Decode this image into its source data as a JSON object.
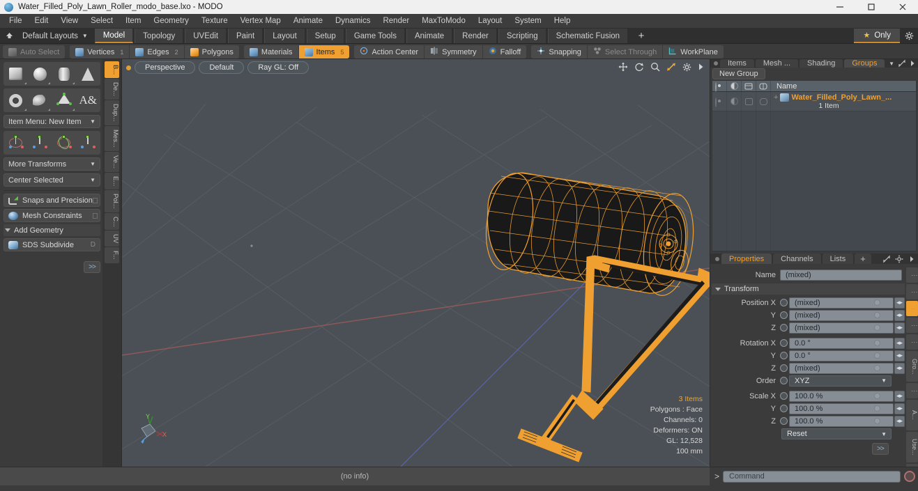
{
  "titlebar": {
    "title": "Water_Filled_Poly_Lawn_Roller_modo_base.lxo - MODO",
    "app_icon": "modo-sphere-icon",
    "minimize": "—",
    "maximize": "□",
    "close": "✕"
  },
  "menubar": {
    "items": [
      {
        "label": "File"
      },
      {
        "label": "Edit"
      },
      {
        "label": "View"
      },
      {
        "label": "Select"
      },
      {
        "label": "Item"
      },
      {
        "label": "Geometry"
      },
      {
        "label": "Texture"
      },
      {
        "label": "Vertex Map"
      },
      {
        "label": "Animate"
      },
      {
        "label": "Dynamics"
      },
      {
        "label": "Render"
      },
      {
        "label": "MaxToModo"
      },
      {
        "label": "Layout"
      },
      {
        "label": "System"
      },
      {
        "label": "Help"
      }
    ]
  },
  "layoutbar": {
    "default_layouts": "Default Layouts",
    "caret": "▼",
    "tabs": [
      {
        "label": "Model",
        "active": true
      },
      {
        "label": "Topology",
        "active": false
      },
      {
        "label": "UVEdit",
        "active": false
      },
      {
        "label": "Paint",
        "active": false
      },
      {
        "label": "Layout",
        "active": false
      },
      {
        "label": "Setup",
        "active": false
      },
      {
        "label": "Game Tools",
        "active": false
      },
      {
        "label": "Animate",
        "active": false
      },
      {
        "label": "Render",
        "active": false
      },
      {
        "label": "Scripting",
        "active": false
      },
      {
        "label": "Schematic Fusion",
        "active": false
      }
    ],
    "add_tab": "+",
    "only_label": "Only",
    "star": "★"
  },
  "modebar": {
    "group1": [
      {
        "label": "Auto Select",
        "num": "",
        "state": "dim",
        "icon": "shield-icon"
      }
    ],
    "group2": [
      {
        "label": "Vertices",
        "num": "1",
        "state": "normal",
        "icon": "vertices-cube-icon"
      },
      {
        "label": "Edges",
        "num": "2",
        "state": "normal",
        "icon": "edges-cube-icon"
      },
      {
        "label": "Polygons",
        "num": "",
        "state": "normal",
        "icon": "polygons-cube-icon"
      }
    ],
    "group3": [
      {
        "label": "Materials",
        "num": "",
        "state": "normal",
        "icon": "materials-cube-icon"
      },
      {
        "label": "Items",
        "num": "5",
        "state": "active",
        "icon": "items-cube-icon"
      }
    ],
    "group4": [
      {
        "label": "Action Center",
        "num": "",
        "state": "normal",
        "icon": "action-center-icon"
      },
      {
        "label": "Symmetry",
        "num": "",
        "state": "normal",
        "icon": "symmetry-icon"
      },
      {
        "label": "Falloff",
        "num": "",
        "state": "normal",
        "icon": "falloff-icon"
      }
    ],
    "group5": [
      {
        "label": "Snapping",
        "num": "",
        "state": "normal",
        "icon": "snapping-icon"
      },
      {
        "label": "Select Through",
        "num": "",
        "state": "dim",
        "icon": "select-through-icon"
      },
      {
        "label": "WorkPlane",
        "num": "",
        "state": "normal",
        "icon": "workplane-icon"
      }
    ]
  },
  "leftbar": {
    "primitives_row1": [
      {
        "name": "cube-tool",
        "shape": "box"
      },
      {
        "name": "sphere-tool",
        "shape": "sphere"
      },
      {
        "name": "cylinder-tool",
        "shape": "cylinder"
      },
      {
        "name": "cone-tool",
        "shape": "cone"
      }
    ],
    "primitives_row2": [
      {
        "name": "torus-tool",
        "shape": "torus"
      },
      {
        "name": "curve-tool",
        "shape": "curve"
      },
      {
        "name": "triangle-tool",
        "shape": "triangle"
      },
      {
        "name": "text-tool",
        "shape": "text"
      }
    ],
    "item_menu": "Item Menu: New Item",
    "transform_row": [
      {
        "name": "move-tool"
      },
      {
        "name": "rotate-tool"
      },
      {
        "name": "scale-tool"
      },
      {
        "name": "transform-tool"
      }
    ],
    "more_transforms": "More Transforms",
    "center_selected": "Center Selected",
    "snaps_precision": "Snaps and Precision",
    "mesh_constraints": "Mesh Constraints",
    "add_geometry": "Add Geometry",
    "sds_subdivide": "SDS Subdivide",
    "sds_key": "D",
    "expand": ">>",
    "vtabs": [
      {
        "label": "B...",
        "active": true
      },
      {
        "label": "De...",
        "active": false
      },
      {
        "label": "Dup...",
        "active": false
      },
      {
        "label": "Mes...",
        "active": false
      },
      {
        "label": "Ve...",
        "active": false
      },
      {
        "label": "E...",
        "active": false
      },
      {
        "label": "Pol...",
        "active": false
      },
      {
        "label": "C...",
        "active": false
      },
      {
        "label": "UV",
        "active": false
      },
      {
        "label": "F...",
        "active": false
      }
    ]
  },
  "viewport": {
    "perspective": "Perspective",
    "shading": "Default",
    "raygl": "Ray GL: Off",
    "nav_icons": [
      "pan-icon",
      "rotate-icon",
      "zoom-icon",
      "fit-icon",
      "settings-gear-icon",
      "expand-arrow-icon"
    ],
    "stats": {
      "items": "3 Items",
      "polygons": "Polygons : Face",
      "channels": "Channels: 0",
      "deformers": "Deformers: ON",
      "gl": "GL: 12,528",
      "scale": "100 mm"
    },
    "axis_labels": {
      "x": "X",
      "y": "Y",
      "z": "Z"
    }
  },
  "rightpanel": {
    "top_tabs": [
      {
        "label": "Items",
        "active": false
      },
      {
        "label": "Mesh ...",
        "active": false
      },
      {
        "label": "Shading",
        "active": false
      },
      {
        "label": "Groups",
        "active": true
      }
    ],
    "top_caret": "▼",
    "new_group_button": "New Group",
    "list": {
      "columns": [
        "eye-icon",
        "shading-icon",
        "render-box-icon",
        "lock-box-icon"
      ],
      "name_header": "Name",
      "rows": [
        {
          "label": "Water_Filled_Poly_Lawn_...",
          "sub": "1 Item",
          "plus": "+"
        }
      ]
    },
    "prop_tabs": [
      {
        "label": "Properties",
        "active": true
      },
      {
        "label": "Channels",
        "active": false
      },
      {
        "label": "Lists",
        "active": false
      },
      {
        "label": "+",
        "active": false
      }
    ],
    "properties": {
      "name_label": "Name",
      "name_value": "(mixed)",
      "transform_header": "Transform",
      "position": {
        "label": "Position X",
        "x": "(mixed)",
        "y": "(mixed)",
        "z": "(mixed)",
        "y_label": "Y",
        "z_label": "Z"
      },
      "rotation": {
        "label": "Rotation X",
        "x": "0.0 °",
        "y": "0.0 °",
        "z": "(mixed)",
        "y_label": "Y",
        "z_label": "Z"
      },
      "order_label": "Order",
      "order_value": "XYZ",
      "scale": {
        "label": "Scale X",
        "x": "100.0 %",
        "y": "100.0 %",
        "z": "100.0 %",
        "y_label": "Y",
        "z_label": "Z"
      },
      "reset": "Reset",
      "expand": ">>"
    },
    "prop_vtabs": [
      {
        "label": "Gro...",
        "active": false
      },
      {
        "label": "A...",
        "active": false
      },
      {
        "label": "Use...",
        "active": false
      }
    ]
  },
  "statusbar": {
    "info": "(no info)"
  },
  "commandbar": {
    "prompt": ">",
    "placeholder": "Command",
    "record_icon": "record-icon"
  }
}
